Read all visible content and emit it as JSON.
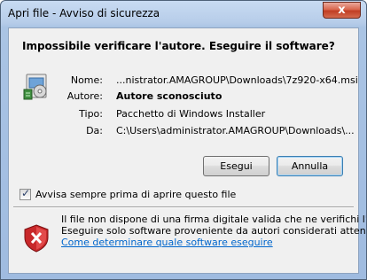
{
  "window": {
    "title": "Apri file - Avviso di sicurezza",
    "close_glyph": "x"
  },
  "dialog": {
    "question": "Impossibile verificare l'autore. Eseguire il software?",
    "file_icon": "windows-installer-package-icon",
    "fields": {
      "name_label": "Nome:",
      "name_value": "...nistrator.AMAGROUP\\Downloads\\7z920-x64.msi",
      "publisher_label": "Autore:",
      "publisher_value": "Autore sconosciuto",
      "type_label": "Tipo:",
      "type_value": "Pacchetto di Windows Installer",
      "from_label": "Da:",
      "from_value": "C:\\Users\\administrator.AMAGROUP\\Downloads\\..."
    },
    "buttons": {
      "run_label": "Esegui",
      "cancel_label": "Annulla"
    },
    "checkbox": {
      "label": "Avvisa sempre prima di aprire questo file",
      "checked": true
    },
    "warning": {
      "icon": "red-shield-x-icon",
      "line1": "Il file non dispone di una firma digitale valida che ne verifichi l'autore.",
      "line2": "Eseguire solo software proveniente da autori considerati attendibili.",
      "link": "Come determinare quale software eseguire"
    }
  }
}
